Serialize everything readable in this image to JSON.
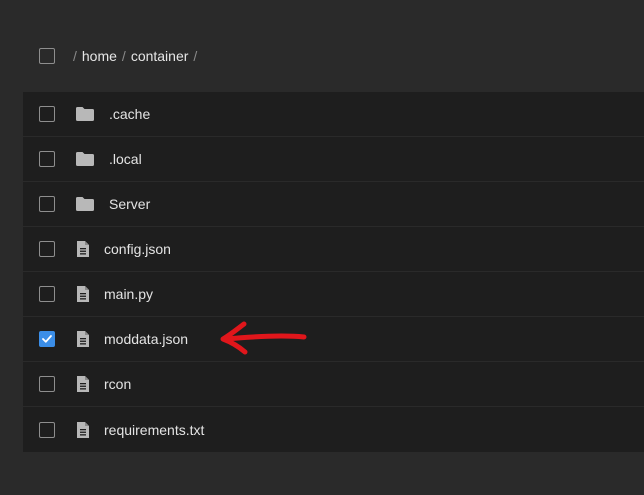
{
  "breadcrumb": {
    "separator": "/",
    "segments": [
      "home",
      "container"
    ]
  },
  "files": [
    {
      "name": ".cache",
      "type": "folder",
      "icon": "folder-icon",
      "checked": false
    },
    {
      "name": ".local",
      "type": "folder",
      "icon": "folder-icon",
      "checked": false
    },
    {
      "name": "Server",
      "type": "folder",
      "icon": "folder-icon",
      "checked": false
    },
    {
      "name": "config.json",
      "type": "file",
      "icon": "file-icon",
      "checked": false
    },
    {
      "name": "main.py",
      "type": "file",
      "icon": "file-icon",
      "checked": false
    },
    {
      "name": "moddata.json",
      "type": "file",
      "icon": "file-icon",
      "checked": true
    },
    {
      "name": "rcon",
      "type": "file",
      "icon": "file-icon",
      "checked": false
    },
    {
      "name": "requirements.txt",
      "type": "file",
      "icon": "file-icon",
      "checked": false
    }
  ],
  "colors": {
    "background": "#2a2a2a",
    "list_background": "#1e1e1e",
    "checkbox_checked": "#3b8ee8",
    "annotation_arrow": "#e0161b",
    "icon": "#b8b8b8"
  },
  "annotation": {
    "icon": "red-arrow-icon",
    "points_to": "moddata.json"
  }
}
